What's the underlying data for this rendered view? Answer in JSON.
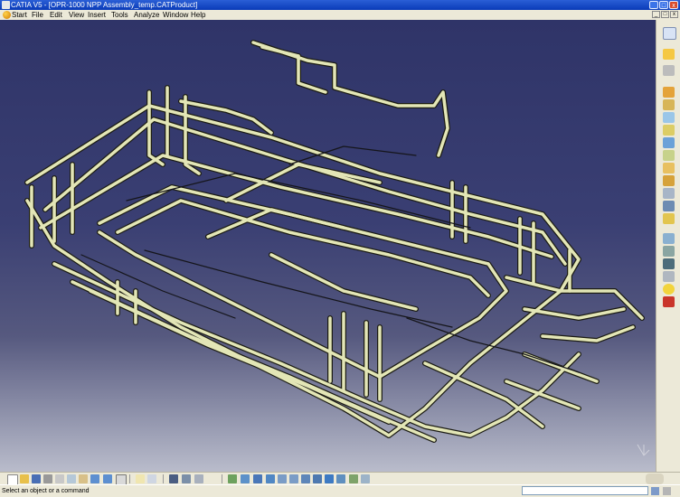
{
  "window": {
    "title": "CATIA V5 - [OPR-1000 NPP Assembly_temp.CATProduct]",
    "controls": [
      "_",
      "□",
      "x"
    ]
  },
  "menubar": {
    "items": [
      {
        "label": "Start"
      },
      {
        "label": "File"
      },
      {
        "label": "Edit"
      },
      {
        "label": "View"
      },
      {
        "label": "Insert"
      },
      {
        "label": "Tools"
      },
      {
        "label": "Analyze"
      },
      {
        "label": "Window"
      },
      {
        "label": "Help"
      }
    ],
    "doc_controls": [
      "_",
      "□",
      "x"
    ]
  },
  "viewport": {
    "background_top": "#2f3468",
    "background_bottom": "#b9bccb",
    "pipe_color": "#e3e6b6",
    "pipe_outline": "#1c1c14"
  },
  "right_toolbar": {
    "icons": [
      "compass-icon",
      "select-icon",
      "fly-icon",
      "product-structure-icon",
      "component-icon",
      "part-icon",
      "existing-component-icon",
      "replace-component-icon",
      "graph-tree-icon",
      "generate-numbering-icon",
      "bill-of-material-icon",
      "constraint-icon",
      "snap-icon",
      "manipulate-icon",
      "explode-icon",
      "clash-icon",
      "measure-icon",
      "section-icon",
      "light-icon",
      "delete-icon"
    ]
  },
  "bottom_toolbar": {
    "icons": [
      "new-icon",
      "open-icon",
      "save-icon",
      "print-icon",
      "cut-icon",
      "copy-icon",
      "paste-icon",
      "undo-icon",
      "redo-icon",
      "whats-this-icon",
      "formula-icon",
      "comment-icon",
      "catalog-icon",
      "sketcher-icon",
      "part-design-icon",
      "fly-mode-icon",
      "fit-all-icon",
      "pan-icon",
      "rotate-icon",
      "zoom-in-icon",
      "zoom-out-icon",
      "normal-view-icon",
      "multi-view-icon",
      "iso-view-icon",
      "render-style-icon",
      "hide-show-icon",
      "swap-visible-icon"
    ]
  },
  "statusbar": {
    "message": "Select an object or a command",
    "command_value": ""
  }
}
